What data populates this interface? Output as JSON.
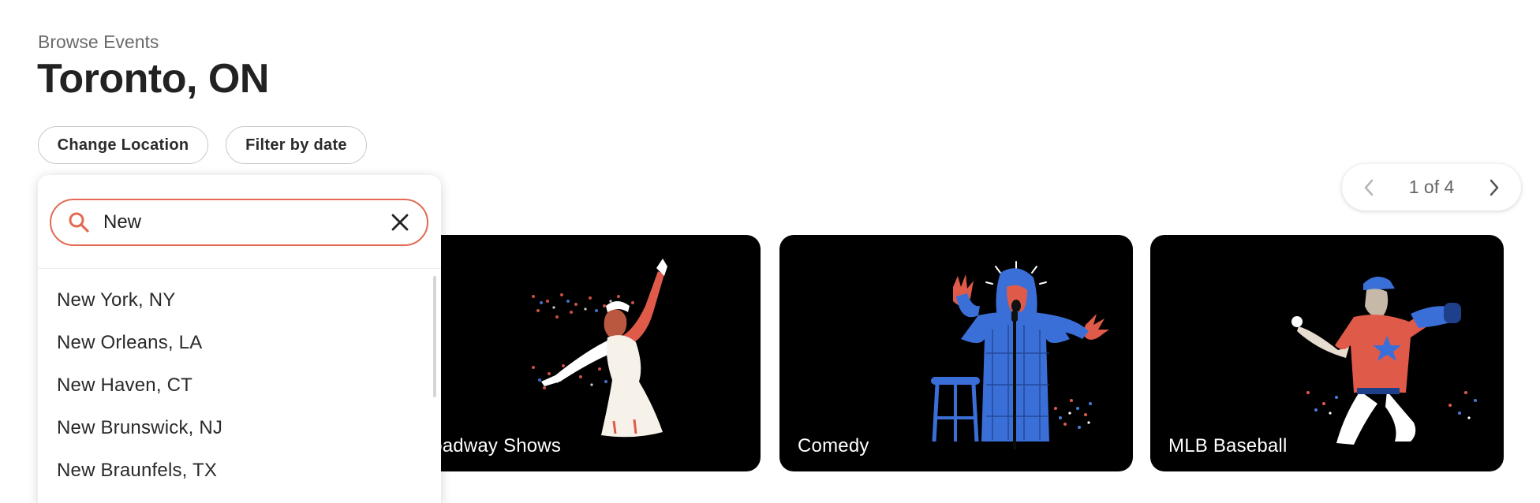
{
  "header": {
    "eyebrow": "Browse Events",
    "title": "Toronto, ON"
  },
  "filters": {
    "change_location": "Change Location",
    "filter_by_date": "Filter by date"
  },
  "pager": {
    "text": "1 of 4",
    "prev_icon": "chevron-left-icon",
    "next_icon": "chevron-right-icon"
  },
  "location_search": {
    "value": "New",
    "search_icon": "search-icon",
    "clear_icon": "close-icon",
    "results": [
      "New York, NY",
      "New Orleans, LA",
      "New Haven, CT",
      "New Brunswick, NJ",
      "New Braunfels, TX"
    ]
  },
  "categories": [
    {
      "label": "Broadway Shows",
      "visible_label": "roadway Shows"
    },
    {
      "label": "Comedy"
    },
    {
      "label": "MLB Baseball"
    }
  ],
  "colors": {
    "accent": "#e26a54",
    "card_bg": "#000000",
    "illustration_blue": "#3b6fd8"
  }
}
